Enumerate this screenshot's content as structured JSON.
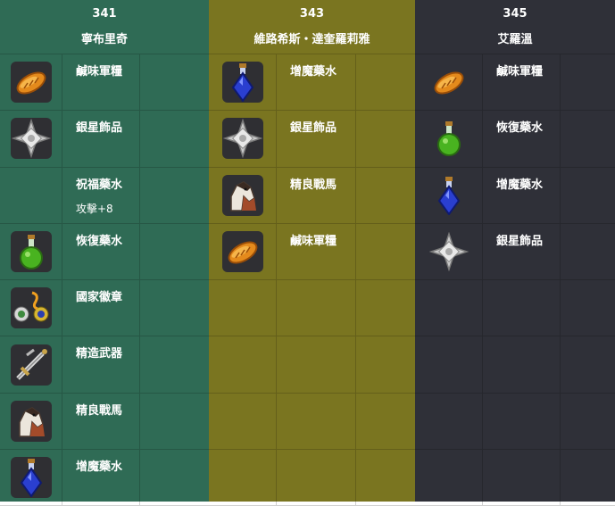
{
  "columns": [
    {
      "id": "341",
      "name": "寧布里奇",
      "items": [
        {
          "label": "鹹味軍糧",
          "icon": "bread-icon"
        },
        {
          "label": "銀星飾品",
          "icon": "silver-star-icon"
        },
        {
          "label": "祝福藥水",
          "sub": "攻擊+8",
          "icon": ""
        },
        {
          "label": "恢復藥水",
          "icon": "green-potion-icon"
        },
        {
          "label": "國家徽章",
          "icon": "emblem-icon"
        },
        {
          "label": "精造武器",
          "icon": "weapon-icon"
        },
        {
          "label": "精良戰馬",
          "icon": "horse-icon"
        },
        {
          "label": "增魔藥水",
          "icon": "blue-potion-icon"
        }
      ]
    },
    {
      "id": "343",
      "name": "維路希斯・達奎羅莉雅",
      "items": [
        {
          "label": "增魔藥水",
          "icon": "blue-potion-icon"
        },
        {
          "label": "銀星飾品",
          "icon": "silver-star-icon"
        },
        {
          "label": "精良戰馬",
          "icon": "horse-icon"
        },
        {
          "label": "鹹味軍糧",
          "icon": "bread-icon"
        },
        {
          "label": "",
          "icon": ""
        },
        {
          "label": "",
          "icon": ""
        },
        {
          "label": "",
          "icon": ""
        },
        {
          "label": "",
          "icon": ""
        }
      ]
    },
    {
      "id": "345",
      "name": "艾羅溫",
      "items": [
        {
          "label": "鹹味軍糧",
          "icon": "bread-icon"
        },
        {
          "label": "恢復藥水",
          "icon": "green-potion-icon"
        },
        {
          "label": "增魔藥水",
          "icon": "blue-potion-icon"
        },
        {
          "label": "銀星飾品",
          "icon": "silver-star-icon"
        },
        {
          "label": "",
          "icon": ""
        },
        {
          "label": "",
          "icon": ""
        },
        {
          "label": "",
          "icon": ""
        },
        {
          "label": "",
          "icon": ""
        }
      ]
    }
  ]
}
